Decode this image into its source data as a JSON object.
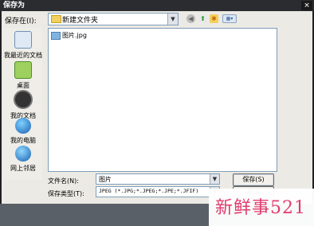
{
  "window": {
    "title": "保存为",
    "close_glyph": "×"
  },
  "toolbar": {
    "save_in_label": "保存在(I):",
    "current_folder": "新建文件夹",
    "icons": [
      "back-icon",
      "up-folder-icon",
      "new-folder-icon",
      "view-menu-icon"
    ]
  },
  "places": [
    {
      "label": "我最近的文档",
      "icon": "recent-documents-icon"
    },
    {
      "label": "桌面",
      "icon": "desktop-icon"
    },
    {
      "label": "我的文档",
      "icon": "my-documents-icon"
    },
    {
      "label": "我的电脑",
      "icon": "my-computer-icon"
    },
    {
      "label": "网上邻居",
      "icon": "network-places-icon"
    }
  ],
  "files": [
    {
      "name": "图片.jpg",
      "icon": "image-file-icon"
    }
  ],
  "form": {
    "filename_label": "文件名(N):",
    "filename_value": "图片",
    "filetype_label": "保存类型(T):",
    "filetype_value": "JPEG (*.JPG;*.JPEG;*.JPE;*.JFIF)"
  },
  "buttons": {
    "save": "保存(S)",
    "cancel": "取消"
  },
  "watermark": {
    "text": "新鲜事521"
  },
  "colors": {
    "accent": "#e43a6e",
    "titlebar": "#2a2c30",
    "dialog_bg": "#eceae4"
  }
}
